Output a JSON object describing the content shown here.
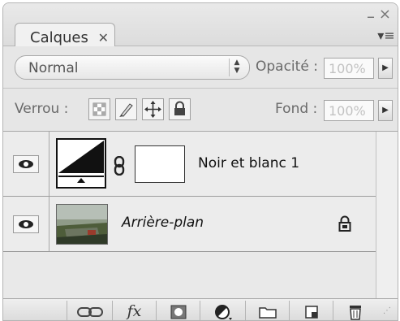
{
  "tab": {
    "label": "Calques",
    "close_glyph": "✕"
  },
  "window": {
    "minimize_glyph": "–",
    "close_glyph": "×",
    "menu_glyph": "▾≡"
  },
  "blend": {
    "mode": "Normal",
    "opacity_label": "Opacité :",
    "opacity_value": "100%"
  },
  "lock": {
    "label": "Verrou :",
    "fill_label": "Fond :",
    "fill_value": "100%",
    "icons": [
      "lock-transparent-icon",
      "lock-paint-icon",
      "lock-move-icon",
      "lock-all-icon"
    ]
  },
  "layers": [
    {
      "name": "Noir et blanc 1",
      "type": "adjustment",
      "visible": true,
      "italic": false
    },
    {
      "name": "Arrière-plan",
      "type": "background",
      "visible": true,
      "italic": true,
      "locked": true
    }
  ],
  "toolbar": {
    "buttons": [
      "link-layers-icon",
      "fx-icon",
      "add-mask-icon",
      "adjustment-layer-icon",
      "new-group-icon",
      "new-layer-icon",
      "trash-icon"
    ],
    "fx_label": "fx"
  },
  "colors": {
    "panel_bg": "#e6e6e6",
    "field_text": "#c2c2c2"
  }
}
